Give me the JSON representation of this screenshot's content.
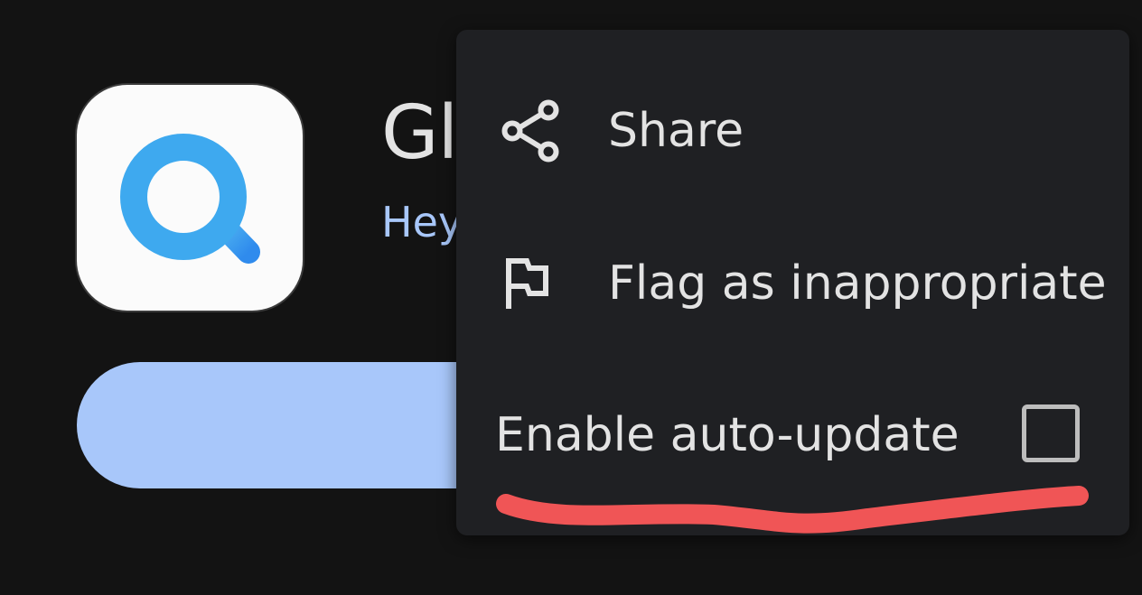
{
  "app": {
    "title_partial": "Gl",
    "developer_partial": "Hey",
    "icon": "magnifier-logo-icon"
  },
  "menu": {
    "items": [
      {
        "label": "Share",
        "icon": "share-icon"
      },
      {
        "label": "Flag as inappropriate",
        "icon": "flag-icon"
      },
      {
        "label": "Enable auto-update",
        "checked": false
      }
    ]
  },
  "colors": {
    "background": "#131313",
    "menu_background": "#1f2023",
    "menu_text": "#e3e3e3",
    "accent": "#a8c7fa",
    "annotation_red": "#f05556",
    "logo_blue": "#3ea9ef"
  }
}
